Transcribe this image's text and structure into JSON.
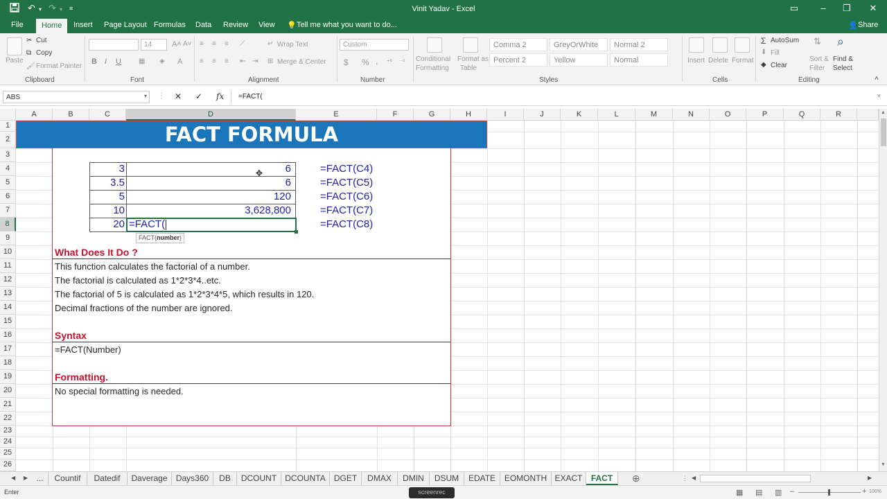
{
  "window": {
    "title": "Vinit Yadav  -  Excel",
    "share_label": "Share"
  },
  "ribbon_tabs": [
    "File",
    "Home",
    "Insert",
    "Page Layout",
    "Formulas",
    "Data",
    "Review",
    "View"
  ],
  "tell_me": "Tell me what you want to do...",
  "ribbon": {
    "clipboard": {
      "paste": "Paste",
      "cut": "Cut",
      "copy": "Copy",
      "format_painter": "Format Painter",
      "group": "Clipboard"
    },
    "font": {
      "size": "14",
      "group": "Font"
    },
    "alignment": {
      "wrap": "Wrap Text",
      "merge": "Merge & Center",
      "group": "Alignment"
    },
    "number": {
      "format": "Custom",
      "currency": "$",
      "percent": "%",
      "comma": ",",
      "group": "Number"
    },
    "styles": {
      "conditional_1": "Conditional",
      "conditional_2": "Formatting",
      "format_table_1": "Format as",
      "format_table_2": "Table",
      "cells": [
        "Comma 2",
        "GreyOrWhite",
        "Normal 2",
        "Percent 2",
        "Yellow",
        "Normal"
      ],
      "group": "Styles"
    },
    "cells": {
      "insert": "Insert",
      "delete": "Delete",
      "format": "Format",
      "group": "Cells"
    },
    "editing": {
      "autosum": "AutoSum",
      "fill": "Fill",
      "clear": "Clear",
      "sort_1": "Sort &",
      "sort_2": "Filter",
      "find_1": "Find &",
      "find_2": "Select",
      "group": "Editing"
    }
  },
  "formula_bar": {
    "name_box": "ABS",
    "cancel": "✕",
    "enter": "✓",
    "fx": "fx",
    "content": "=FACT("
  },
  "columns": [
    "A",
    "B",
    "C",
    "D",
    "E",
    "F",
    "G",
    "H",
    "I",
    "J",
    "K",
    "L",
    "M",
    "N",
    "O",
    "P",
    "Q",
    "R"
  ],
  "rows": [
    "1",
    "2",
    "3",
    "4",
    "5",
    "6",
    "7",
    "8",
    "9",
    "10",
    "11",
    "12",
    "13",
    "14",
    "15",
    "16",
    "17",
    "18",
    "19",
    "20",
    "21",
    "22",
    "23",
    "24",
    "25",
    "26"
  ],
  "sheet": {
    "banner": "FACT FORMULA",
    "table": [
      {
        "input": "3",
        "result": "6",
        "formula": "=FACT(C4)"
      },
      {
        "input": "3.5",
        "result": "6",
        "formula": "=FACT(C5)"
      },
      {
        "input": "5",
        "result": "120",
        "formula": "=FACT(C6)"
      },
      {
        "input": "10",
        "result": "3,628,800",
        "formula": "=FACT(C7)"
      },
      {
        "input": "20",
        "result": "=FACT(",
        "formula": "=FACT(C8)"
      }
    ],
    "tooltip_fn": "FACT(",
    "tooltip_arg": "number",
    "tooltip_close": ")",
    "what_heading": "What Does It Do ?",
    "what_lines": [
      "This function calculates the factorial of a number.",
      "The factorial is calculated as 1*2*3*4..etc.",
      "The factorial of 5 is calculated as 1*2*3*4*5, which results in 120.",
      "Decimal fractions of the number are ignored."
    ],
    "syntax_heading": "Syntax",
    "syntax_line": "=FACT(Number)",
    "format_heading": "Formatting.",
    "format_line": "No special formatting is needed."
  },
  "sheet_tabs": [
    "...",
    "Countif",
    "Datedif",
    "Daverage",
    "Days360",
    "DB",
    "DCOUNT",
    "DCOUNTA",
    "DGET",
    "DMAX",
    "DMIN",
    "DSUM",
    "EDATE",
    "EOMONTH",
    "EXACT",
    "FACT"
  ],
  "active_sheet": "FACT",
  "status": {
    "mode": "Enter",
    "zoom": "100%",
    "watermark": "screenrec"
  },
  "colors": {
    "excel_green": "#217346",
    "banner_blue": "#1a75bb",
    "heading_red": "#c8102e",
    "value_blue": "#1f1fa8"
  }
}
